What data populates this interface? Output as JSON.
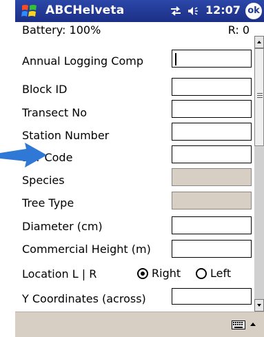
{
  "titlebar": {
    "app_title": "ABCHelveta",
    "time": "12:07",
    "ok_label": "ok"
  },
  "status": {
    "battery": "Battery: 100%",
    "records": "R: 0"
  },
  "fields": [
    {
      "label": "Annual Logging Comp",
      "value": ""
    },
    {
      "label": "Block ID",
      "value": ""
    },
    {
      "label": "Transect No",
      "value": ""
    },
    {
      "label": "Station Number",
      "value": ""
    },
    {
      "label": "Bar Code",
      "value": ""
    },
    {
      "label": "Species",
      "value": ""
    },
    {
      "label": "Tree Type",
      "value": ""
    },
    {
      "label": "Diameter (cm)",
      "value": ""
    },
    {
      "label": "Commercial Height (m)",
      "value": ""
    },
    {
      "label": "Y Coordinates (across)",
      "value": ""
    }
  ],
  "location": {
    "label": "Location L | R",
    "option_right": "Right",
    "option_left": "Left",
    "selected": "Right"
  },
  "colors": {
    "titlebar": "#1f3a96",
    "disabled_field": "#d8cfc4",
    "pointer_arrow": "#2f78d6"
  }
}
